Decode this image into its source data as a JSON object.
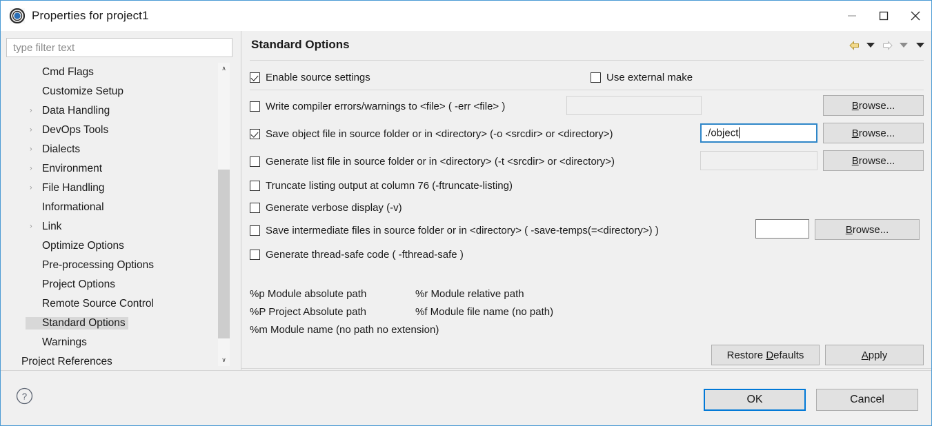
{
  "window": {
    "title": "Properties for project1",
    "app_icon": "eclipse-icon",
    "controls": [
      {
        "name": "minimize-button",
        "glyph": "—"
      },
      {
        "name": "maximize-button",
        "glyph": "□"
      },
      {
        "name": "close-button",
        "glyph": "✕"
      }
    ]
  },
  "sidebar": {
    "filter": {
      "value": "",
      "placeholder": "type filter text"
    },
    "items": [
      {
        "label": "Cmd Flags",
        "expandable": false,
        "depth": 1,
        "selected": false
      },
      {
        "label": "Customize Setup",
        "expandable": false,
        "depth": 1,
        "selected": false
      },
      {
        "label": "Data Handling",
        "expandable": true,
        "depth": 1,
        "selected": false
      },
      {
        "label": "DevOps Tools",
        "expandable": true,
        "depth": 1,
        "selected": false
      },
      {
        "label": "Dialects",
        "expandable": true,
        "depth": 1,
        "selected": false
      },
      {
        "label": "Environment",
        "expandable": true,
        "depth": 1,
        "selected": false
      },
      {
        "label": "File Handling",
        "expandable": true,
        "depth": 1,
        "selected": false
      },
      {
        "label": "Informational",
        "expandable": false,
        "depth": 1,
        "selected": false
      },
      {
        "label": "Link",
        "expandable": true,
        "depth": 1,
        "selected": false
      },
      {
        "label": "Optimize Options",
        "expandable": false,
        "depth": 1,
        "selected": false
      },
      {
        "label": "Pre-processing Options",
        "expandable": false,
        "depth": 1,
        "selected": false
      },
      {
        "label": "Project Options",
        "expandable": false,
        "depth": 1,
        "selected": false
      },
      {
        "label": "Remote Source Control",
        "expandable": false,
        "depth": 1,
        "selected": false
      },
      {
        "label": "Standard Options",
        "expandable": false,
        "depth": 1,
        "selected": true
      },
      {
        "label": "Warnings",
        "expandable": false,
        "depth": 1,
        "selected": false
      },
      {
        "label": "Project References",
        "expandable": false,
        "depth": 0,
        "selected": false
      }
    ],
    "scrollbar": {
      "up_glyph": "∧",
      "down_glyph": "∨"
    }
  },
  "main": {
    "title": "Standard Options",
    "nav": [
      {
        "name": "back-arrow-icon",
        "state": "enabled"
      },
      {
        "name": "back-dropdown-icon",
        "state": "enabled"
      },
      {
        "name": "forward-arrow-icon",
        "state": "disabled"
      },
      {
        "name": "forward-dropdown-icon",
        "state": "disabled"
      },
      {
        "name": "menu-dropdown-icon",
        "state": "enabled"
      }
    ],
    "options": [
      {
        "id": "enable-source-settings",
        "label": "Enable source settings",
        "checked": true
      },
      {
        "id": "use-external-make",
        "label": "Use external make",
        "checked": false
      },
      {
        "id": "write-compiler-errors",
        "label": "Write compiler errors/warnings to <file> ( -err <file> )",
        "checked": false,
        "field": {
          "value": "",
          "state": "disabled"
        },
        "browse": "Browse..."
      },
      {
        "id": "save-object-file",
        "label": "Save object file in source folder or in <directory> (-o <srcdir> or <directory>)",
        "checked": true,
        "field": {
          "value": "./object",
          "state": "focused"
        },
        "browse": "Browse..."
      },
      {
        "id": "generate-list-file",
        "label": "Generate list file in source folder or in <directory> (-t  <srcdir> or <directory>)",
        "checked": false,
        "field": {
          "value": "",
          "state": "disabled"
        },
        "browse": "Browse..."
      },
      {
        "id": "truncate-listing",
        "label": "Truncate listing output at column 76 (-ftruncate-listing)",
        "checked": false
      },
      {
        "id": "generate-verbose",
        "label": "Generate verbose display (-v)",
        "checked": false
      },
      {
        "id": "save-intermediate-files",
        "label": "Save intermediate files in source folder or in <directory> ( -save-temps(=<directory>) )",
        "checked": false,
        "field": {
          "value": "",
          "state": "enabled"
        },
        "browse": "Browse..."
      },
      {
        "id": "generate-thread-safe",
        "label": "Generate thread-safe code ( -fthread-safe )",
        "checked": false
      }
    ],
    "legend": [
      {
        "left": "%p Module absolute path",
        "right": "%r Module relative path"
      },
      {
        "left": "%P Project Absolute path",
        "right": "%f Module file name (no path)"
      },
      {
        "left": "%m Module name (no path no extension)",
        "right": ""
      }
    ],
    "restore_defaults_label": "Restore Defaults",
    "restore_defaults_mnemonic": "D",
    "apply_label": "Apply",
    "apply_mnemonic": "A",
    "browse_mnemonic": "B"
  },
  "footer": {
    "help_icon": "question-mark-icon",
    "ok_label": "OK",
    "cancel_label": "Cancel"
  },
  "colors": {
    "focus_blue": "#0078d7",
    "field_focus_border": "#2f86c8",
    "selection_gray": "#d8d8d8",
    "panel_bg": "#f0f0f0",
    "back_arrow_gold": "#e8c14a"
  }
}
